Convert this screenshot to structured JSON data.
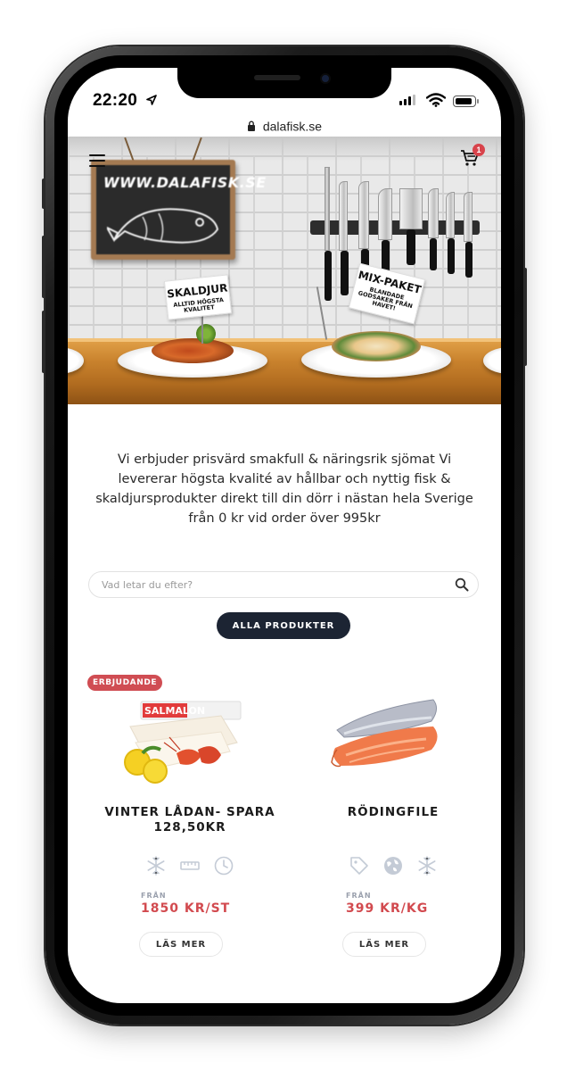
{
  "status_bar": {
    "time": "22:20"
  },
  "browser": {
    "url": "dalafisk.se"
  },
  "header": {
    "cart_count": "1"
  },
  "hero": {
    "brand_board": "WWW.DALAFISK.SE",
    "sign_left": {
      "title": "SKALDJUR",
      "subtitle": "ALLTID HÖGSTA KVALITET"
    },
    "sign_right": {
      "title": "MIX-PAKET",
      "subtitle": "BLANDADE GODSAKER FRÅN HAVET!"
    }
  },
  "intro_text": "Vi erbjuder prisvärd smakfull & näringsrik sjömat Vi levererar högsta kvalité av hållbar och nyttig fisk & skaldjursprodukter direkt till din dörr i nästan hela Sverige från 0 kr vid order över 995kr",
  "search": {
    "placeholder": "Vad letar du efter?"
  },
  "all_products_label": "ALLA PRODUKTER",
  "products": [
    {
      "badge": "ERBJUDANDE",
      "package_label": "SALMALON",
      "name": "VINTER LÅDAN- SPARA 128,50KR",
      "icons": [
        "snowflake-icon",
        "ruler-icon",
        "clock-icon"
      ],
      "from_label": "FRÅN",
      "price": "1850 KR/ST",
      "more_label": "LÄS MER"
    },
    {
      "name": "RÖDINGFILE",
      "icons": [
        "tag-icon",
        "globe-icon",
        "snowflake-icon"
      ],
      "from_label": "FRÅN",
      "price": "399 KR/KG",
      "more_label": "LÄS MER"
    }
  ],
  "colors": {
    "accent_red": "#d24a4f",
    "badge_red": "#d04d53",
    "button_dark": "#1c2433",
    "icon_gray": "#c4cbd6"
  }
}
